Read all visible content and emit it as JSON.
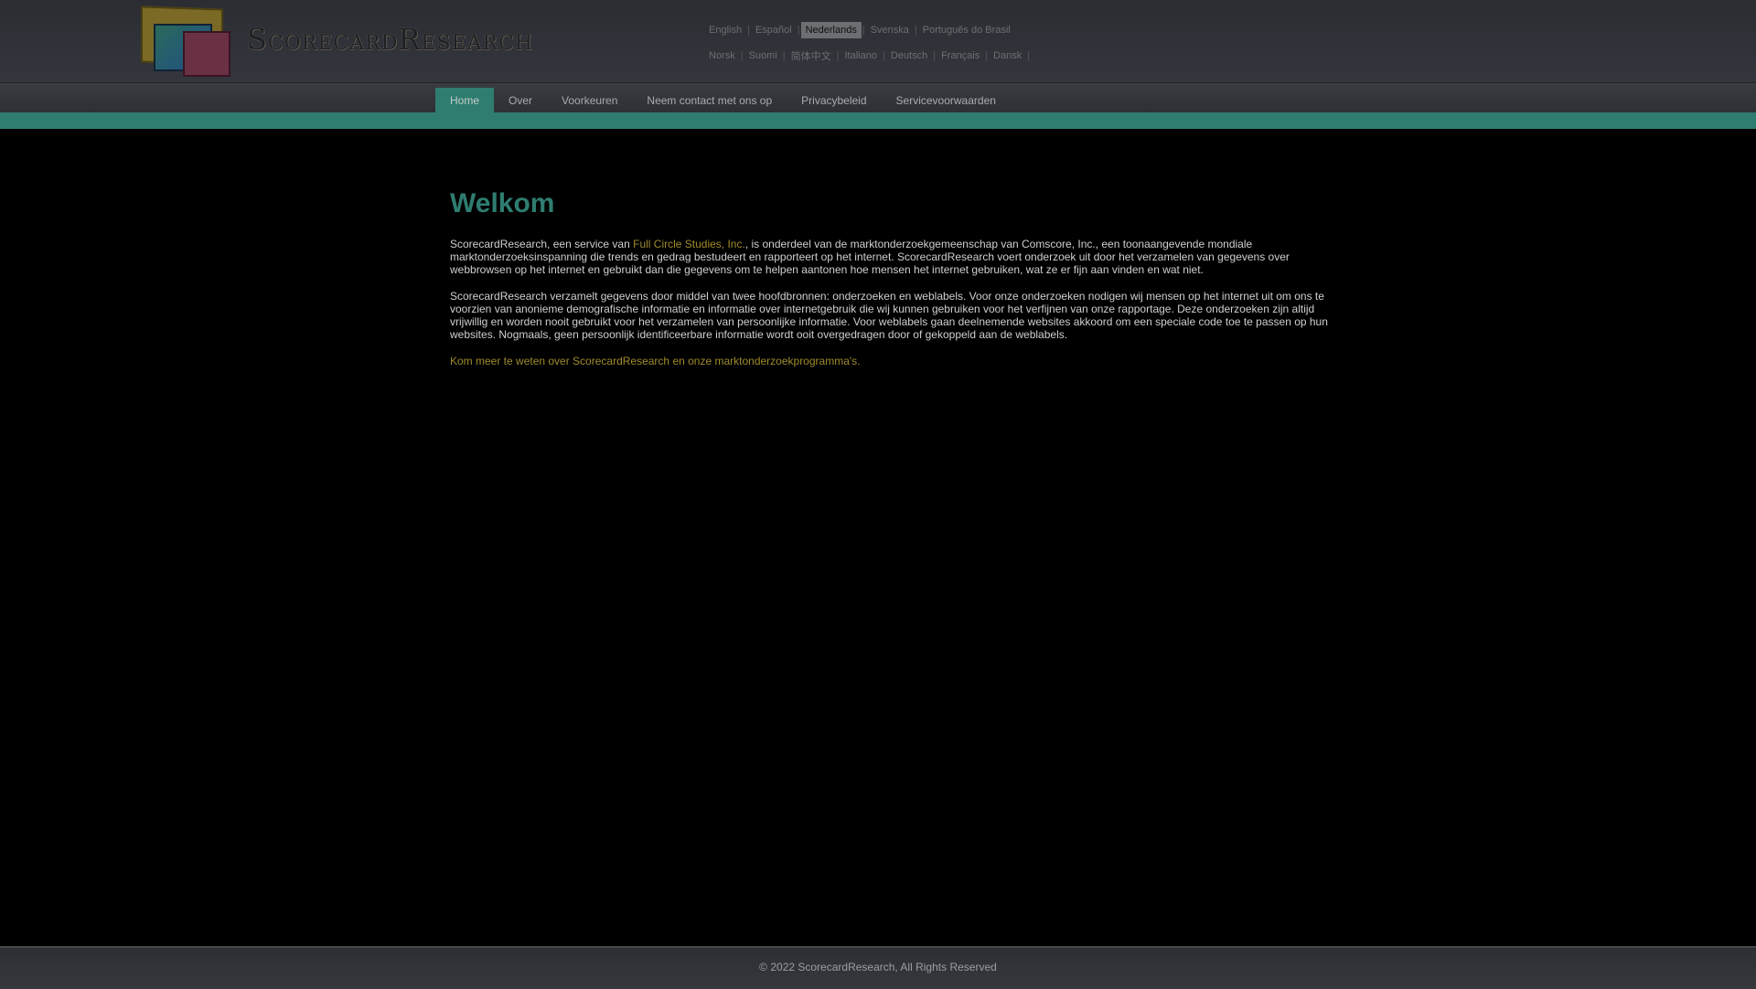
{
  "brand": {
    "name": "ScorecardResearch"
  },
  "languages": {
    "row1": [
      "English",
      "Español",
      "Nederlands",
      "Svenska",
      "Português do Brasil"
    ],
    "row2": [
      "Norsk",
      "Suomi",
      "简体中文",
      "Italiano",
      "Deutsch",
      "Français",
      "Dansk"
    ],
    "active": "Nederlands"
  },
  "nav": {
    "items": [
      "Home",
      "Over",
      "Voorkeuren",
      "Neem contact met ons op",
      "Privacybeleid",
      "Servicevoorwaarden"
    ],
    "active": "Home"
  },
  "content": {
    "title": "Welkom",
    "p1_before": "ScorecardResearch, een service van ",
    "p1_link": "Full Circle Studies, Inc.",
    "p1_after": ", is onderdeel van de marktonderzoekgemeenschap van Comscore, Inc., een toonaangevende mondiale marktonderzoeksinspanning die trends en gedrag bestudeert en rapporteert op het internet. ScorecardResearch voert onderzoek uit door het verzamelen van gegevens over webbrowsen op het internet en gebruikt dan die gegevens om te helpen aantonen hoe mensen het internet gebruiken, wat ze er fijn aan vinden en wat niet.",
    "p2": "ScorecardResearch verzamelt gegevens door middel van twee hoofdbronnen: onderzoeken en weblabels. Voor onze onderzoeken nodigen wij mensen op het internet uit om ons te voorzien van anonieme demografische informatie en informatie over internetgebruik die wij kunnen gebruiken voor het verfijnen van onze rapportage. Deze onderzoeken zijn altijd vrijwillig en worden nooit gebruikt voor het verzamelen van persoonlijke informatie. Voor weblabels gaan deelnemende websites akkoord om een speciale code toe te passen op hun websites. Nogmaals, geen persoonlijk identificeerbare informatie wordt ooit overgedragen door of gekoppeld aan de weblabels.",
    "more_link": "Kom meer te weten over ScorecardResearch en onze marktonderzoekprogramma's."
  },
  "footer": {
    "text": "© 2022 ScorecardResearch, All Rights Reserved"
  },
  "colors": {
    "accent": "#2f7d70",
    "link": "#9f8a2c"
  }
}
